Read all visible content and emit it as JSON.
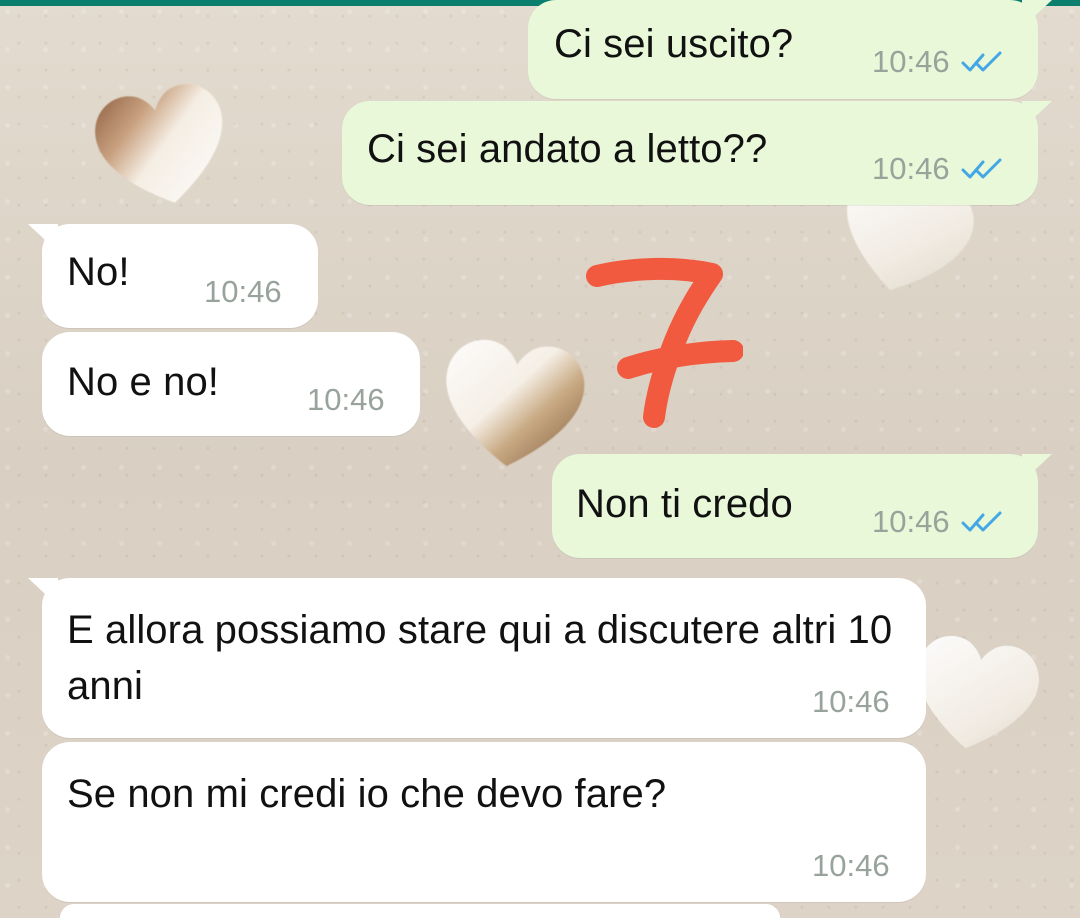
{
  "chat": {
    "messages": [
      {
        "direction": "outgoing",
        "text": "Ci sei uscito?",
        "time": "10:46",
        "status_icon": "double-check-icon"
      },
      {
        "direction": "outgoing",
        "text": "Ci sei andato a letto??",
        "time": "10:46",
        "status_icon": "double-check-icon"
      },
      {
        "direction": "incoming",
        "text": "No!",
        "time": "10:46"
      },
      {
        "direction": "incoming",
        "text": "No e no!",
        "time": "10:46"
      },
      {
        "direction": "outgoing",
        "text": "Non ti credo",
        "time": "10:46",
        "status_icon": "double-check-icon"
      },
      {
        "direction": "incoming",
        "text": "E allora possiamo stare qui a discutere altri 10 anni",
        "time": "10:46"
      },
      {
        "direction": "incoming",
        "text": "Se non mi credi io che devo fare?",
        "time": "10:46"
      }
    ]
  },
  "annotation": {
    "text": "7",
    "color": "#f15a3f"
  },
  "theme": {
    "header_accent": "#0a7f6d",
    "incoming_bubble": "#ffffff",
    "outgoing_bubble": "#e8f8d9",
    "timestamp": "#98a39b",
    "read_ticks": "#43a7e6"
  }
}
